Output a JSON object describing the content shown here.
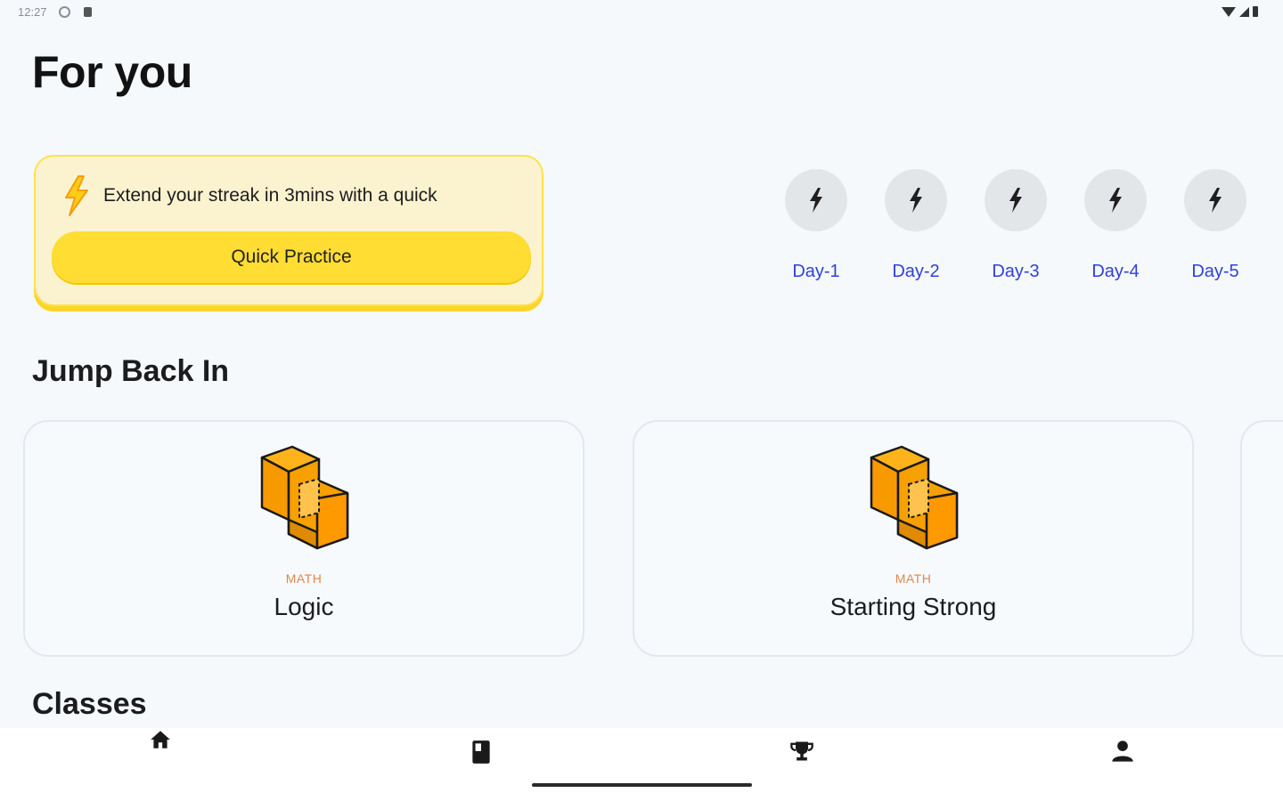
{
  "status_bar": {
    "time": "12:27"
  },
  "header": {
    "title": "For you"
  },
  "streak": {
    "message": "Extend your streak in 3mins with a quick",
    "button_label": "Quick Practice"
  },
  "days": [
    {
      "label": "Day-1"
    },
    {
      "label": "Day-2"
    },
    {
      "label": "Day-3"
    },
    {
      "label": "Day-4"
    },
    {
      "label": "Day-5"
    }
  ],
  "jump_back_in": {
    "title": "Jump Back In",
    "courses": [
      {
        "subject": "MATH",
        "title": "Logic",
        "icon": "orange-cube-icon"
      },
      {
        "subject": "MATH",
        "title": "Starting Strong",
        "icon": "orange-cube-icon"
      }
    ]
  },
  "classes": {
    "title": "Classes"
  },
  "bottom_nav": {
    "items": [
      {
        "icon": "home-icon"
      },
      {
        "icon": "book-icon"
      },
      {
        "icon": "trophy-icon"
      },
      {
        "icon": "profile-icon"
      }
    ]
  },
  "colors": {
    "accent_yellow": "#ffdd33",
    "streak_bg": "#fbf3d0",
    "day_label": "#3140d8",
    "subject_label": "#e0874a",
    "cube_orange": "#f7a000"
  }
}
